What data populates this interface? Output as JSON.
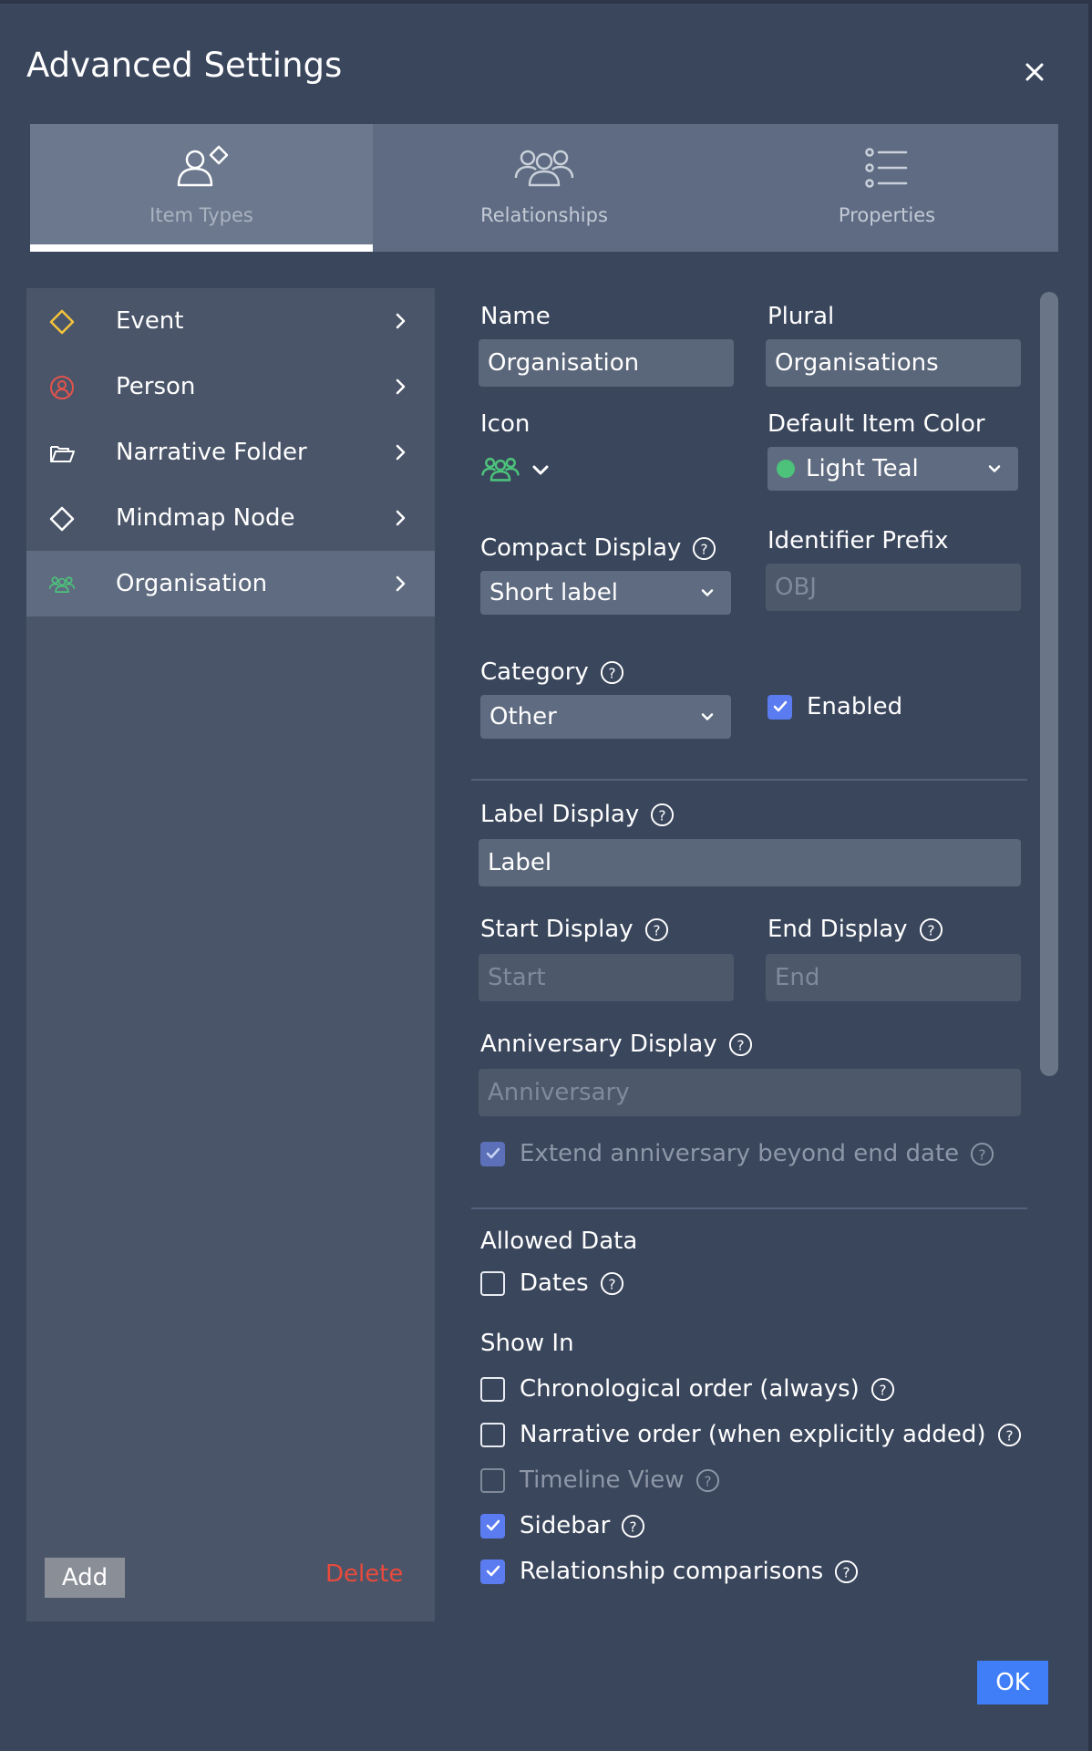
{
  "dialog": {
    "title": "Advanced Settings",
    "ok_label": "OK"
  },
  "tabs": [
    {
      "label": "Item Types",
      "icon": "person-diamond-icon",
      "active": true
    },
    {
      "label": "Relationships",
      "icon": "group-icon",
      "active": false
    },
    {
      "label": "Properties",
      "icon": "list-icon",
      "active": false
    }
  ],
  "item_types": [
    {
      "label": "Event",
      "icon": "diamond-icon",
      "icon_color": "#f5c33b"
    },
    {
      "label": "Person",
      "icon": "person-circle-icon",
      "icon_color": "#e5534b"
    },
    {
      "label": "Narrative Folder",
      "icon": "folder-icon",
      "icon_color": "#ffffff"
    },
    {
      "label": "Mindmap Node",
      "icon": "diamond-icon",
      "icon_color": "#ffffff"
    },
    {
      "label": "Organisation",
      "icon": "group-icon",
      "icon_color": "#4cc27a",
      "selected": true
    }
  ],
  "list_actions": {
    "add_label": "Add",
    "delete_label": "Delete"
  },
  "form": {
    "name_label": "Name",
    "name_value": "Organisation",
    "plural_label": "Plural",
    "plural_value": "Organisations",
    "icon_label": "Icon",
    "icon_value": "group-icon",
    "color_label": "Default Item Color",
    "color_value": "Light Teal",
    "color_swatch": "#4cc27a",
    "compact_label": "Compact Display",
    "compact_value": "Short label",
    "prefix_label": "Identifier Prefix",
    "prefix_placeholder": "OBJ",
    "category_label": "Category",
    "category_value": "Other",
    "enabled_label": "Enabled",
    "label_display_label": "Label Display",
    "label_display_value": "Label",
    "start_label": "Start Display",
    "start_placeholder": "Start",
    "end_label": "End Display",
    "end_placeholder": "End",
    "anniversary_label": "Anniversary Display",
    "anniversary_placeholder": "Anniversary",
    "extend_label": "Extend anniversary beyond end date",
    "allowed_data_label": "Allowed Data",
    "dates_label": "Dates",
    "show_in_label": "Show In",
    "chrono_label": "Chronological order (always)",
    "narrative_label": "Narrative order (when explicitly added)",
    "timeline_label": "Timeline View",
    "sidebar_label": "Sidebar",
    "relcomp_label": "Relationship comparisons"
  },
  "colors": {
    "accent": "#3f7ef7",
    "checkbox": "#5b7cf0",
    "delete": "#e84a3c"
  }
}
